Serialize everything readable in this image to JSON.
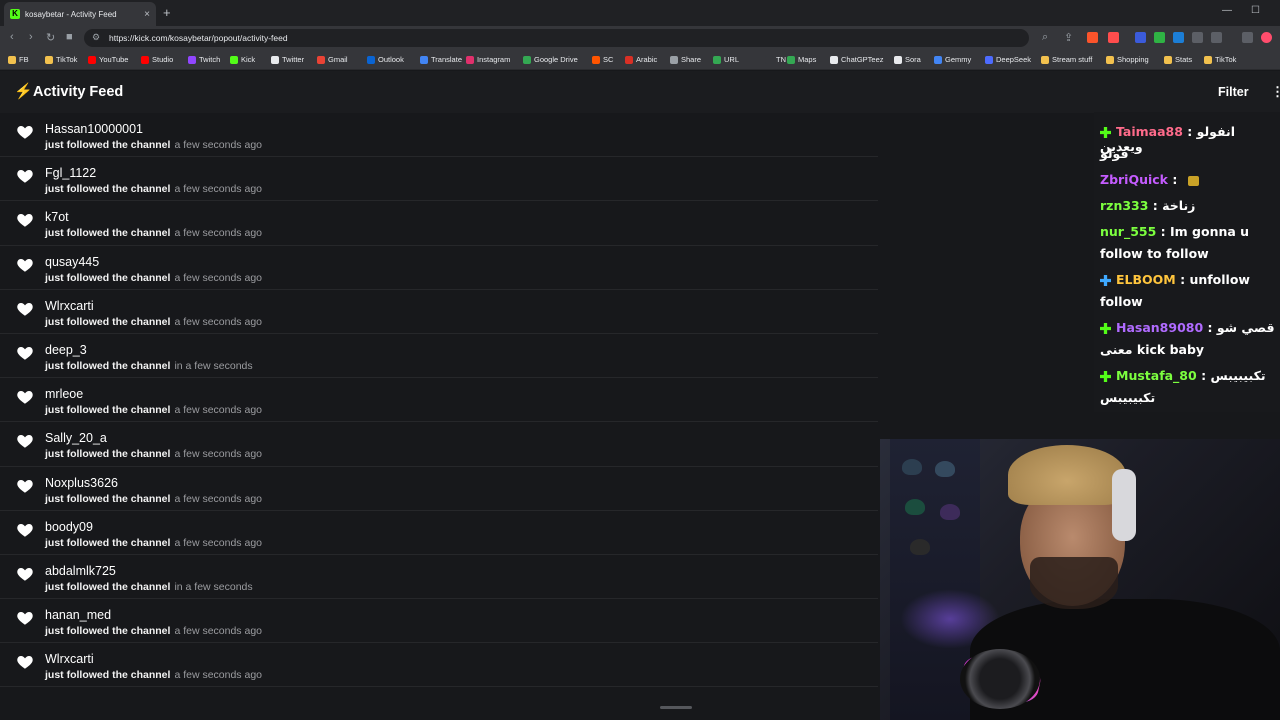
{
  "browser": {
    "tab_title": "kosaybetar - Activity Feed",
    "tab_close": "×",
    "new_tab": "+",
    "url": "https://kick.com/kosaybetar/popout/activity-feed",
    "bookmarks": [
      {
        "label": "FB",
        "color": "#f2c14e"
      },
      {
        "label": "TikTok",
        "color": "#f2c14e"
      },
      {
        "label": "YouTube",
        "color": "#ff0000"
      },
      {
        "label": "Studio",
        "color": "#ff0000"
      },
      {
        "label": "Twitch",
        "color": "#9146ff"
      },
      {
        "label": "Kick",
        "color": "#53fc18"
      },
      {
        "label": "Twitter",
        "color": "#e8eaed"
      },
      {
        "label": "Gmail",
        "color": "#ea4335"
      },
      {
        "label": "Outlook",
        "color": "#0a64d2"
      },
      {
        "label": "Translate",
        "color": "#4285f4"
      },
      {
        "label": "Instagram",
        "color": "#e1306c"
      },
      {
        "label": "Google Drive",
        "color": "#34a853"
      },
      {
        "label": "SC",
        "color": "#ff5500"
      },
      {
        "label": "Arabic",
        "color": "#d93025"
      },
      {
        "label": "Share",
        "color": "#9aa0a6"
      },
      {
        "label": "URL",
        "color": "#34a853"
      },
      {
        "label": "TN",
        "color": "#35363a"
      },
      {
        "label": "Maps",
        "color": "#34a853"
      },
      {
        "label": "ChatGPTeez",
        "color": "#e8eaed"
      },
      {
        "label": "Sora",
        "color": "#e8eaed"
      },
      {
        "label": "Gemmy",
        "color": "#4285f4"
      },
      {
        "label": "DeepSeek",
        "color": "#4d6bfe"
      },
      {
        "label": "Stream stuff",
        "color": "#f2c14e"
      },
      {
        "label": "Shopping",
        "color": "#f2c14e"
      },
      {
        "label": "Stats",
        "color": "#f2c14e"
      },
      {
        "label": "TikTok",
        "color": "#f2c14e"
      }
    ]
  },
  "header": {
    "title": "Activity Feed",
    "filter_label": "Filter"
  },
  "feed": {
    "items": [
      {
        "username": "Hassan10000001",
        "action": "just followed the channel",
        "time": "a few seconds ago"
      },
      {
        "username": "Fgl_1122",
        "action": "just followed the channel",
        "time": "a few seconds ago"
      },
      {
        "username": "k7ot",
        "action": "just followed the channel",
        "time": "a few seconds ago"
      },
      {
        "username": "qusay445",
        "action": "just followed the channel",
        "time": "a few seconds ago"
      },
      {
        "username": "Wlrxcarti",
        "action": "just followed the channel",
        "time": "a few seconds ago"
      },
      {
        "username": "deep_3",
        "action": "just followed the channel",
        "time": "in a few seconds"
      },
      {
        "username": "mrleoe",
        "action": "just followed the channel",
        "time": "a few seconds ago"
      },
      {
        "username": "Sally_20_a",
        "action": "just followed the channel",
        "time": "a few seconds ago"
      },
      {
        "username": "Noxplus3626",
        "action": "just followed the channel",
        "time": "a few seconds ago"
      },
      {
        "username": "boody09",
        "action": "just followed the channel",
        "time": "a few seconds ago"
      },
      {
        "username": "abdalmlk725",
        "action": "just followed the channel",
        "time": "in a few seconds"
      },
      {
        "username": "hanan_med",
        "action": "just followed the channel",
        "time": "a few seconds ago"
      },
      {
        "username": "Wlrxcarti",
        "action": "just followed the channel",
        "time": "a few seconds ago"
      }
    ]
  },
  "chat": {
    "messages": [
      {
        "user": "Taimaa88",
        "color": "#ff6b8b",
        "badge": "#53fc18",
        "text": ": انفولو ويعدين",
        "cont": "فولو"
      },
      {
        "user": "ZbriQuick",
        "color": "#c55cff",
        "badge": "",
        "text": ":",
        "cont": ""
      },
      {
        "user": "rzn333",
        "color": "#7cff3f",
        "badge": "",
        "text": ": زناخة",
        "cont": ""
      },
      {
        "user": "nur_555",
        "color": "#7cff3f",
        "badge": "",
        "text": ": Im gonna u",
        "cont": "follow to follow"
      },
      {
        "user": "ELBOOM",
        "color": "#ffc53d",
        "badge": "#3fa9ff",
        "text": ": unfollow",
        "cont": "follow"
      },
      {
        "user": "Hasan89080",
        "color": "#b06bff",
        "badge": "#53fc18",
        "text": ": قصي شو",
        "cont": "معنى kick baby"
      },
      {
        "user": "Mustafa_80",
        "color": "#7cff3f",
        "badge": "#53fc18",
        "text": ": تكبيبيبس",
        "cont": "تكبيبيبس"
      }
    ]
  }
}
